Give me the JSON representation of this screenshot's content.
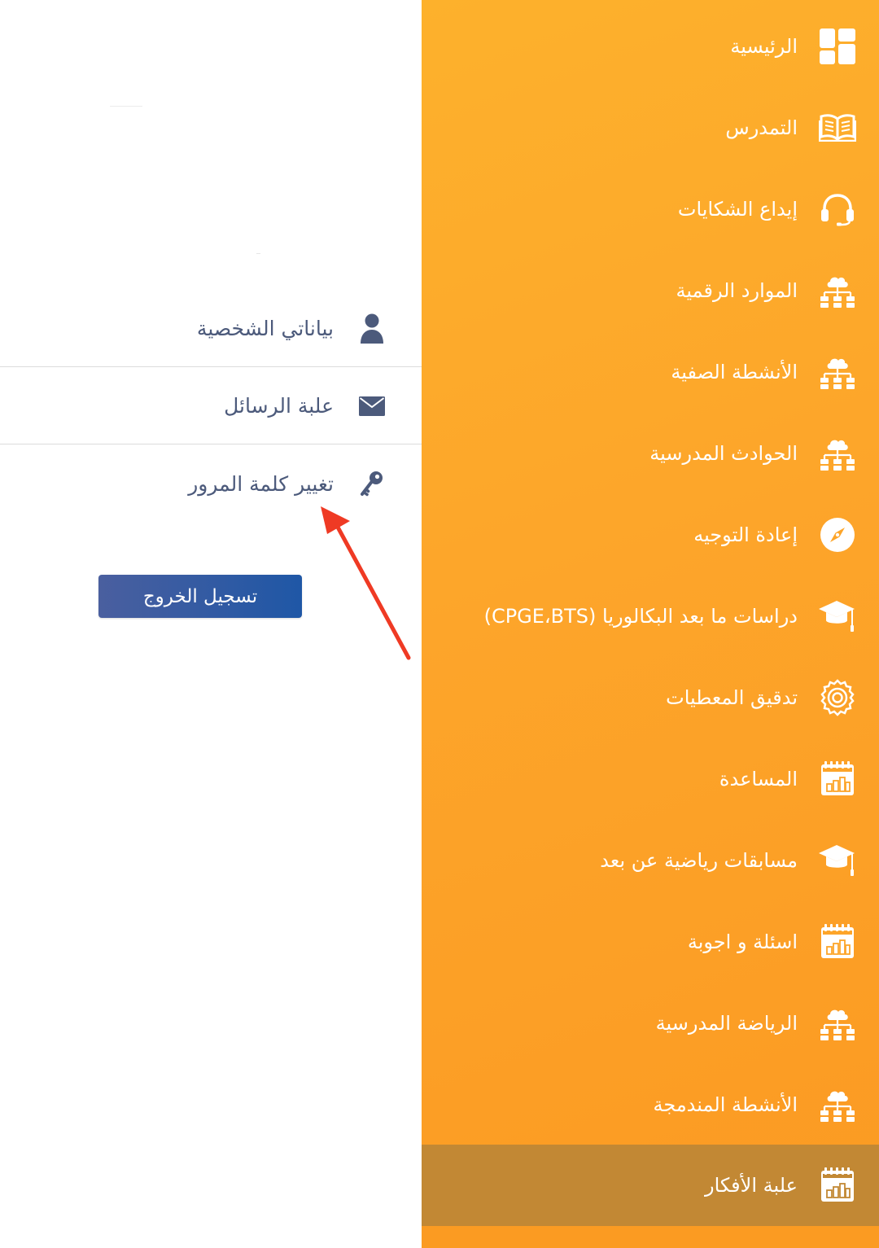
{
  "account_menu": {
    "items": [
      {
        "label": "بياناتي الشخصية",
        "icon": "user-icon"
      },
      {
        "label": "علبة الرسائل",
        "icon": "envelope-icon"
      },
      {
        "label": "تغيير كلمة المرور",
        "icon": "key-icon"
      }
    ],
    "logout_label": "تسجيل الخروج"
  },
  "drawer": {
    "items": [
      {
        "label": "الرئيسية",
        "icon": "dashboard-icon"
      },
      {
        "label": "التمدرس",
        "icon": "book-icon"
      },
      {
        "label": "إيداع الشكايات",
        "icon": "headset-icon"
      },
      {
        "label": "الموارد الرقمية",
        "icon": "cloud-network-icon"
      },
      {
        "label": "الأنشطة الصفية",
        "icon": "cloud-network-icon"
      },
      {
        "label": "الحوادث المدرسية",
        "icon": "cloud-network-icon"
      },
      {
        "label": "إعادة التوجيه",
        "icon": "compass-icon"
      },
      {
        "label": "دراسات ما بعد البكالوريا (CPGE،BTS)",
        "icon": "graduation-cap-icon"
      },
      {
        "label": "تدقيق المعطيات",
        "icon": "gear-icon"
      },
      {
        "label": "المساعدة",
        "icon": "calendar-chart-icon"
      },
      {
        "label": "مسابقات رياضية عن بعد",
        "icon": "graduation-cap-icon"
      },
      {
        "label": "اسئلة و اجوبة",
        "icon": "calendar-chart-icon"
      },
      {
        "label": "الرياضة المدرسية",
        "icon": "cloud-network-icon"
      },
      {
        "label": "الأنشطة المندمجة",
        "icon": "cloud-network-icon"
      },
      {
        "label": "علبة الأفكار",
        "icon": "calendar-chart-icon"
      }
    ],
    "active_index": 14
  },
  "colors": {
    "drawer_orange": "#fda52a",
    "active_item": "#c28834",
    "account_text": "#4c5a7b",
    "logout_button": "#2f5aa3",
    "annotation_arrow": "#ef3a24"
  }
}
